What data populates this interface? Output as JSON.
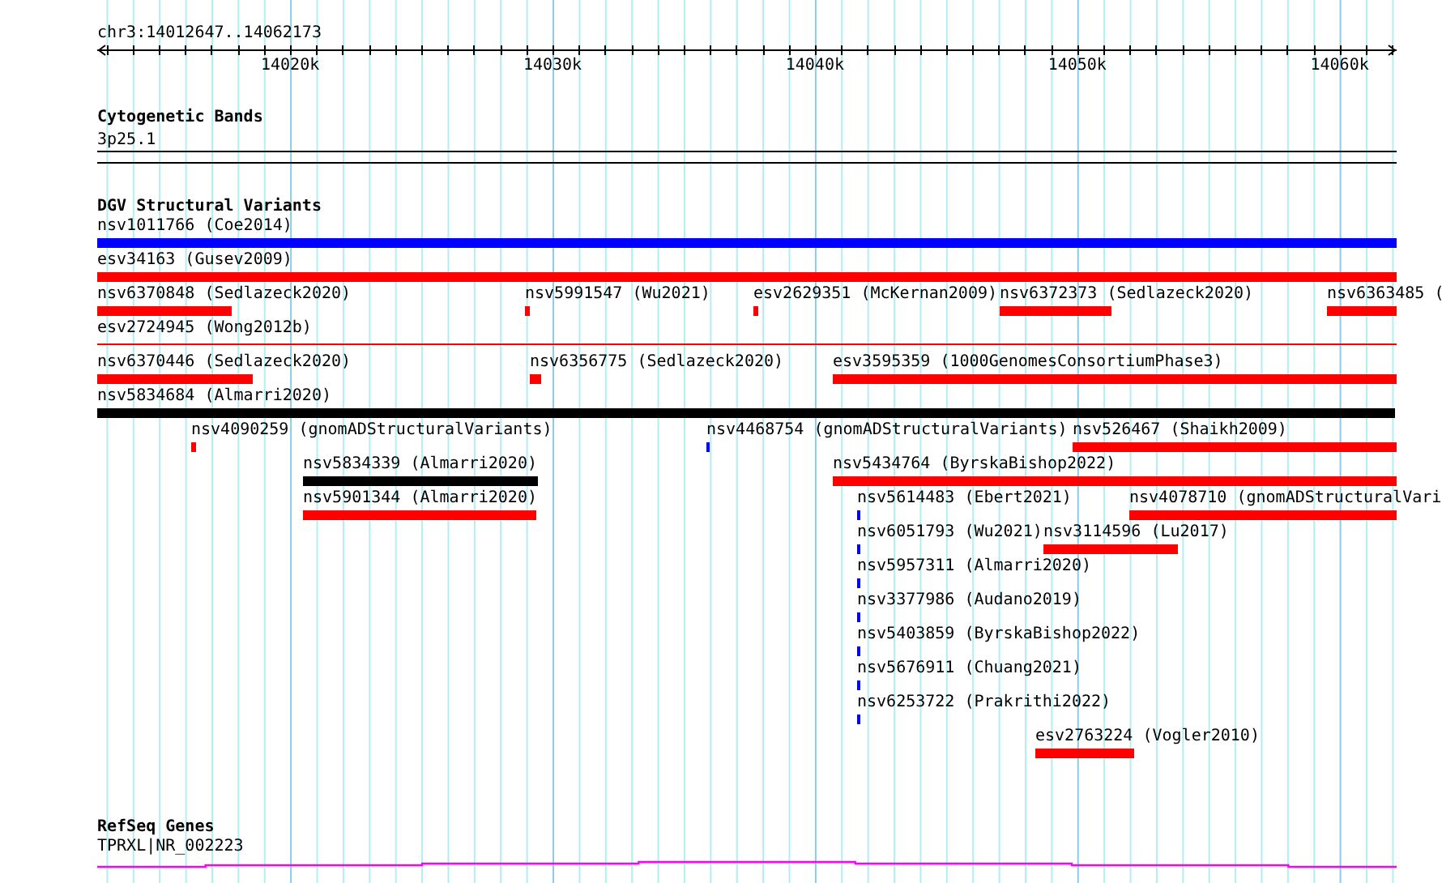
{
  "locus": "chr3:14012647..14062173",
  "axis": {
    "ticks": [
      {
        "label": "14020k"
      },
      {
        "label": "14030k"
      },
      {
        "label": "14040k"
      },
      {
        "label": "14050k"
      },
      {
        "label": "14060k"
      }
    ]
  },
  "tracks": [
    {
      "kind": "bands",
      "title": "Cytogenetic Bands",
      "features": [
        {
          "name": "3p25.1"
        }
      ]
    },
    {
      "kind": "variants",
      "title": "DGV Structural Variants",
      "lanes": [
        {
          "features": [
            {
              "label": "nsv1011766 (Coe2014)",
              "color": "#0000ff",
              "kind": "bar"
            }
          ]
        },
        {
          "features": [
            {
              "label": "esv34163 (Gusev2009)",
              "color": "#ff0000",
              "kind": "bar"
            }
          ]
        },
        {
          "features": [
            {
              "label": "nsv6370848 (Sedlazeck2020)",
              "color": "#ff0000",
              "kind": "bar"
            },
            {
              "label": "nsv5991547 (Wu2021)",
              "color": "#ff0000",
              "kind": "bar"
            },
            {
              "label": "esv2629351 (McKernan2009)",
              "color": "#ff0000",
              "kind": "bar"
            },
            {
              "label": "nsv6372373 (Sedlazeck2020)",
              "color": "#ff0000",
              "kind": "bar"
            },
            {
              "label": "nsv6363485 (",
              "color": "#ff0000",
              "kind": "bar"
            }
          ]
        },
        {
          "features": [
            {
              "label": "esv2724945 (Wong2012b)",
              "color": "#ff0000",
              "kind": "line"
            }
          ]
        },
        {
          "features": [
            {
              "label": "nsv6370446 (Sedlazeck2020)",
              "color": "#ff0000",
              "kind": "bar"
            },
            {
              "label": "nsv6356775 (Sedlazeck2020)",
              "color": "#ff0000",
              "kind": "bar"
            },
            {
              "label": "esv3595359 (1000GenomesConsortiumPhase3)",
              "color": "#ff0000",
              "kind": "bar"
            }
          ]
        },
        {
          "features": [
            {
              "label": "nsv5834684 (Almarri2020)",
              "color": "#000000",
              "kind": "bar"
            }
          ]
        },
        {
          "features": [
            {
              "label": "nsv4090259 (gnomADStructuralVariants)",
              "color": "#ff0000",
              "kind": "bar"
            },
            {
              "label": "nsv4468754 (gnomADStructuralVariants)",
              "color": "#0000ff",
              "kind": "bar"
            },
            {
              "label": "nsv526467 (Shaikh2009)",
              "color": "#ff0000",
              "kind": "bar"
            }
          ]
        },
        {
          "features": [
            {
              "label": "nsv5834339 (Almarri2020)",
              "color": "#000000",
              "kind": "bar"
            },
            {
              "label": "nsv5434764 (ByrskaBishop2022)",
              "color": "#ff0000",
              "kind": "bar"
            }
          ]
        },
        {
          "features": [
            {
              "label": "nsv5901344 (Almarri2020)",
              "color": "#ff0000",
              "kind": "bar"
            },
            {
              "label": "nsv5614483 (Ebert2021)",
              "color": "#0000ff",
              "kind": "bar"
            },
            {
              "label": "nsv4078710 (gnomADStructuralVari",
              "color": "#ff0000",
              "kind": "bar"
            }
          ]
        },
        {
          "features": [
            {
              "label": "nsv6051793 (Wu2021)",
              "color": "#0000ff",
              "kind": "bar"
            },
            {
              "label": "nsv3114596 (Lu2017)",
              "color": "#ff0000",
              "kind": "bar"
            }
          ]
        },
        {
          "features": [
            {
              "label": "nsv5957311 (Almarri2020)",
              "color": "#0000ff",
              "kind": "bar"
            }
          ]
        },
        {
          "features": [
            {
              "label": "nsv3377986 (Audano2019)",
              "color": "#0000ff",
              "kind": "bar"
            }
          ]
        },
        {
          "features": [
            {
              "label": "nsv5403859 (ByrskaBishop2022)",
              "color": "#0000ff",
              "kind": "bar"
            }
          ]
        },
        {
          "features": [
            {
              "label": "nsv5676911 (Chuang2021)",
              "color": "#0000ff",
              "kind": "bar"
            }
          ]
        },
        {
          "features": [
            {
              "label": "nsv6253722 (Prakrithi2022)",
              "color": "#0000ff",
              "kind": "bar"
            }
          ]
        },
        {
          "features": [
            {
              "label": "esv2763224 (Vogler2010)",
              "color": "#ff0000",
              "kind": "bar"
            }
          ]
        }
      ]
    },
    {
      "kind": "genes",
      "title": "RefSeq Genes",
      "features": [
        {
          "name": "TPRXL|NR_002223"
        }
      ]
    }
  ]
}
